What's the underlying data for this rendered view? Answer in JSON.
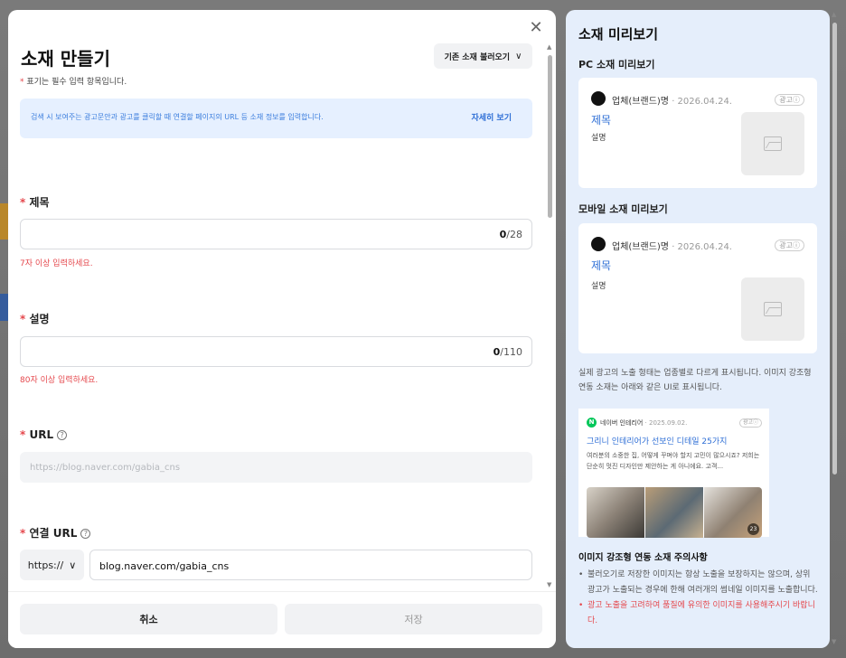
{
  "modal": {
    "title": "소재 만들기",
    "close_icon": "close-icon",
    "load_button_label": "기존 소재 불러오기",
    "required_note": "표기는 필수 입력 항목입니다.",
    "required_mark": "*",
    "info_text": "검색 시 보여주는 광고문안과 광고를 클릭할 때 연결할 페이지의 URL 등 소재 정보를 입력합니다.",
    "info_link": "자세히 보기",
    "fields": {
      "title": {
        "label": "제목",
        "count": "0",
        "max": "/28",
        "error": "7자 이상 입력하세요."
      },
      "description": {
        "label": "설명",
        "count": "0",
        "max": "/110",
        "error": "80자 이상 입력하세요."
      },
      "url": {
        "label": "URL",
        "value": "https://blog.naver.com/gabia_cns"
      },
      "link_url": {
        "label": "연결 URL",
        "protocol": "https://",
        "value": "blog.naver.com/gabia_cns"
      }
    },
    "cancel_label": "취소",
    "save_label": "저장"
  },
  "preview": {
    "title": "소재 미리보기",
    "pc_title": "PC 소재 미리보기",
    "mobile_title": "모바일 소재 미리보기",
    "brand": "업체(브랜드)명",
    "date": " · 2026.04.24.",
    "ad_badge": "광고ⓘ",
    "card_title": "제목",
    "card_desc": "설명",
    "note": "실제 광고의 노출 형태는 업종별로 다르게 표시됩니다. 이미지 강조형 연동 소재는 아래와 같은 UI로 표시됩니다.",
    "example": {
      "logo": "N",
      "brand": "네이버 인테리어",
      "date": " · 2025.09.02.",
      "badge": "광고ⓘ",
      "title": "그리니 인테리어가 선보인 디테일 25가지",
      "desc": "여러분의 소중한 집, 어떻게 꾸며야 할지 고민이 많으시죠? 저희는 단순히 멋진 디자인만 제안하는 게 아니에요. 고객...",
      "count": "23"
    },
    "caution_title": "이미지 강조형 연동 소재 주의사항",
    "cautions": [
      "불러오기로 저장한 이미지는 항상 노출을 보장하지는 않으며, 상위 광고가 노출되는 경우에 한해 여러개의 썸네일 이미지를 노출합니다.",
      "광고 노출을 고려하여 품질에 유의한 이미지를 사용해주시기 바랍니다."
    ]
  }
}
